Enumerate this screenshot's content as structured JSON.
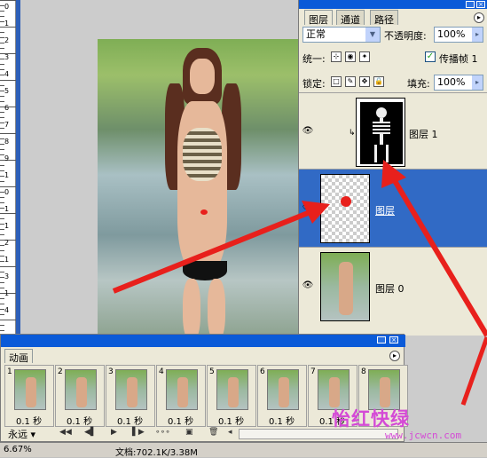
{
  "layers_panel": {
    "tabs": [
      "图层",
      "通道",
      "路径"
    ],
    "blend_mode": "正常",
    "opacity_label": "不透明度:",
    "opacity_value": "100%",
    "unify_label": "统一:",
    "propagate_label": "传播帧 1",
    "lock_label": "锁定:",
    "fill_label": "填充:",
    "fill_value": "100%",
    "layers": [
      {
        "name": "图层 1",
        "thumbnail": "skeleton",
        "visible": true,
        "selected": false
      },
      {
        "name": "图层",
        "thumbnail": "red-dot-transparent",
        "visible": true,
        "selected": true
      },
      {
        "name": "图层 0",
        "thumbnail": "photo",
        "visible": true,
        "selected": false
      }
    ]
  },
  "animation_panel": {
    "tab": "动画",
    "frames": [
      {
        "num": "1",
        "delay": "0.1 秒"
      },
      {
        "num": "2",
        "delay": "0.1 秒"
      },
      {
        "num": "3",
        "delay": "0.1 秒"
      },
      {
        "num": "4",
        "delay": "0.1 秒"
      },
      {
        "num": "5",
        "delay": "0.1 秒"
      },
      {
        "num": "6",
        "delay": "0.1 秒"
      },
      {
        "num": "7",
        "delay": "0.1 秒"
      },
      {
        "num": "8",
        "delay": ""
      }
    ],
    "loop": "永远"
  },
  "statusbar": {
    "zoom": "6.67%",
    "doc": "文档:702.1K/3.38M"
  },
  "ruler": [
    "0",
    "1",
    "2",
    "3",
    "4",
    "5",
    "6",
    "7",
    "8",
    "9",
    "1",
    "0",
    "1",
    "1",
    "2",
    "1",
    "3",
    "1",
    "4"
  ],
  "watermark": {
    "text": "怡红快绿",
    "url": "www.jcwcn.com"
  },
  "colors": {
    "accent_blue": "#316ac5",
    "annotation_red": "#e8201c",
    "watermark": "#d44ad6"
  }
}
